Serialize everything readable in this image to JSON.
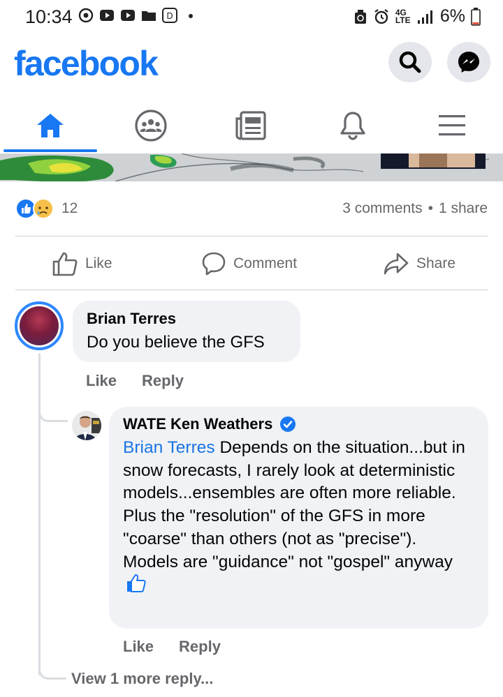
{
  "status_bar": {
    "time": "10:34",
    "network": "4G LTE",
    "battery": "6%"
  },
  "header": {
    "brand": "facebook",
    "brand_color": "#1877f2",
    "search_icon": "search-icon",
    "messenger_icon": "messenger-icon"
  },
  "nav": {
    "tabs": [
      {
        "icon": "home-icon",
        "active": true
      },
      {
        "icon": "groups-icon",
        "active": false
      },
      {
        "icon": "news-icon",
        "active": false
      },
      {
        "icon": "bell-icon",
        "active": false
      },
      {
        "icon": "menu-icon",
        "active": false
      }
    ]
  },
  "post": {
    "reaction_count": "12",
    "comments": "3 comments",
    "separator": "•",
    "shares": "1 share",
    "actions": {
      "like": "Like",
      "comment": "Comment",
      "share": "Share"
    }
  },
  "comments": [
    {
      "author": "Brian Terres",
      "text": "Do you believe the GFS",
      "like": "Like",
      "reply": "Reply"
    }
  ],
  "reply": {
    "author": "WATE Ken Weathers",
    "verified": true,
    "mention": "Brian Terres",
    "text": " Depends on the situation...but in snow forecasts, I rarely look at deterministic models...ensembles are often more reliable. Plus the \"resolution\" of the GFS in more \"coarse\" than others (not as \"precise\"). Models are \"guidance\" not \"gospel\" anyway",
    "like": "Like",
    "reply": "Reply"
  },
  "view_more": "View 1 more reply..."
}
